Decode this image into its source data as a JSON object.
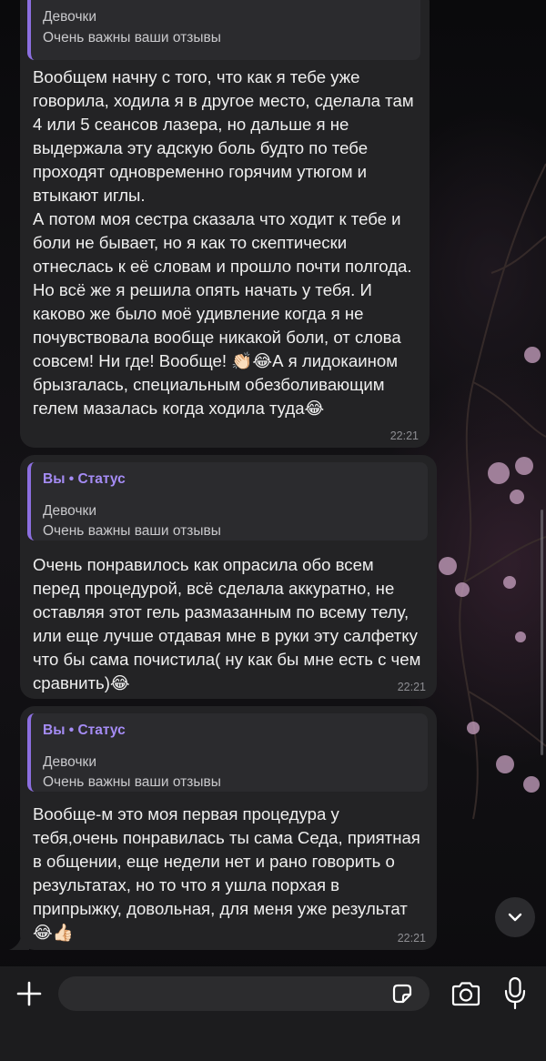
{
  "messages": [
    {
      "quote": {
        "sender": "",
        "line1": "Девочки",
        "line2": "Очень важны ваши отзывы"
      },
      "text": "Вообщем начну с того, что как я тебе уже говорила, ходила я в другое место, сделала там 4 или 5 сеансов лазера, но дальше я не выдержала эту адскую боль будто по тебе проходят одновременно горячим утюгом и втыкают иглы.\nА потом моя сестра сказала что ходит к тебе и боли не бывает, но я как то скептически отнеслась к её словам и прошло почти полгода. Но всё же я решила опять начать у тебя. И каково же было моё удивление когда я не почувствовала вообще никакой боли, от слова совсем! Ни где! Вообще! 👏🏻😂А я лидокаином брызгалась, специальным обезболивающим гелем мазалась когда ходила туда😂",
      "time": "22:21"
    },
    {
      "quote": {
        "sender": "Вы • Статус",
        "line1": "Девочки",
        "line2": "Очень важны ваши отзывы"
      },
      "text": "Очень понравилось как опрасила обо всем перед процедурой, всё сделала аккуратно, не оставляя этот гель размазанным по всему телу, или еще лучше отдавая мне в руки эту салфетку что бы сама почистила( ну как бы мне есть с чем сравнить)😂",
      "time": "22:21"
    },
    {
      "quote": {
        "sender": "Вы • Статус",
        "line1": "Девочки",
        "line2": "Очень важны ваши отзывы"
      },
      "text": "Вообще-м это моя первая процедура у тебя,очень понравилась ты сама Седа, приятная в общении, еще недели нет и рано говорить о результатах, но то что я ушла порхая в припрыжку, довольная, для меня уже результат 😂👍🏻",
      "time": "22:21"
    }
  ],
  "input": {
    "placeholder": ""
  },
  "icons": {
    "plus": "plus-icon",
    "sticker": "sticker-icon",
    "camera": "camera-icon",
    "mic": "microphone-icon",
    "scroll_down": "chevron-down-icon"
  },
  "colors": {
    "bubble": "#232325",
    "quote_bar": "#8c6fe0",
    "sender": "#a58cf5",
    "timestamp": "#8e8e93"
  }
}
